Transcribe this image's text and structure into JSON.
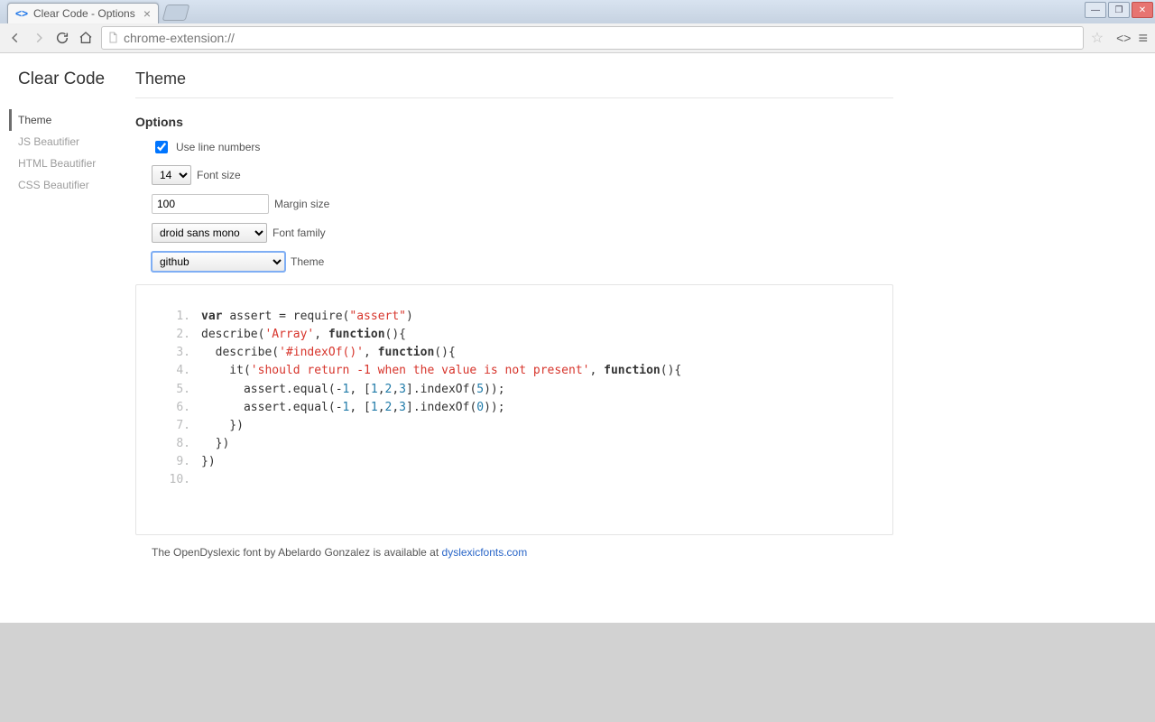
{
  "window": {
    "tab_title": "Clear Code - Options",
    "url": "chrome-extension://"
  },
  "sidebar": {
    "brand": "Clear Code",
    "items": [
      {
        "label": "Theme",
        "active": true
      },
      {
        "label": "JS Beautifier",
        "active": false
      },
      {
        "label": "HTML Beautifier",
        "active": false
      },
      {
        "label": "CSS Beautifier",
        "active": false
      }
    ]
  },
  "main": {
    "heading": "Theme",
    "options_heading": "Options",
    "fields": {
      "use_line_numbers": {
        "label": "Use line numbers",
        "checked": true
      },
      "font_size": {
        "label": "Font size",
        "value": "14"
      },
      "margin_size": {
        "label": "Margin size",
        "value": "100"
      },
      "font_family": {
        "label": "Font family",
        "value": "droid sans mono"
      },
      "theme": {
        "label": "Theme",
        "value": "github"
      }
    },
    "code_lines": [
      {
        "n": "1",
        "tokens": [
          {
            "t": "var ",
            "c": "kw"
          },
          {
            "t": "assert ",
            "c": "fn"
          },
          {
            "t": "= require(",
            "c": "op"
          },
          {
            "t": "\"assert\"",
            "c": "str"
          },
          {
            "t": ")",
            "c": "op"
          }
        ]
      },
      {
        "n": "2",
        "tokens": [
          {
            "t": "describe(",
            "c": "op"
          },
          {
            "t": "'Array'",
            "c": "str"
          },
          {
            "t": ", ",
            "c": "op"
          },
          {
            "t": "function",
            "c": "kw"
          },
          {
            "t": "(){",
            "c": "op"
          }
        ]
      },
      {
        "n": "3",
        "tokens": [
          {
            "t": "  describe(",
            "c": "op"
          },
          {
            "t": "'#indexOf()'",
            "c": "str"
          },
          {
            "t": ", ",
            "c": "op"
          },
          {
            "t": "function",
            "c": "kw"
          },
          {
            "t": "(){",
            "c": "op"
          }
        ]
      },
      {
        "n": "4",
        "tokens": [
          {
            "t": "    it(",
            "c": "op"
          },
          {
            "t": "'should return -1 when the value is not present'",
            "c": "str"
          },
          {
            "t": ", ",
            "c": "op"
          },
          {
            "t": "function",
            "c": "kw"
          },
          {
            "t": "(){",
            "c": "op"
          }
        ]
      },
      {
        "n": "5",
        "tokens": [
          {
            "t": "      assert.equal(-",
            "c": "op"
          },
          {
            "t": "1",
            "c": "num"
          },
          {
            "t": ", [",
            "c": "op"
          },
          {
            "t": "1",
            "c": "num"
          },
          {
            "t": ",",
            "c": "op"
          },
          {
            "t": "2",
            "c": "num"
          },
          {
            "t": ",",
            "c": "op"
          },
          {
            "t": "3",
            "c": "num"
          },
          {
            "t": "].indexOf(",
            "c": "op"
          },
          {
            "t": "5",
            "c": "num"
          },
          {
            "t": "));",
            "c": "op"
          }
        ]
      },
      {
        "n": "6",
        "tokens": [
          {
            "t": "      assert.equal(-",
            "c": "op"
          },
          {
            "t": "1",
            "c": "num"
          },
          {
            "t": ", [",
            "c": "op"
          },
          {
            "t": "1",
            "c": "num"
          },
          {
            "t": ",",
            "c": "op"
          },
          {
            "t": "2",
            "c": "num"
          },
          {
            "t": ",",
            "c": "op"
          },
          {
            "t": "3",
            "c": "num"
          },
          {
            "t": "].indexOf(",
            "c": "op"
          },
          {
            "t": "0",
            "c": "num"
          },
          {
            "t": "));",
            "c": "op"
          }
        ]
      },
      {
        "n": "7",
        "tokens": [
          {
            "t": "    })",
            "c": "op"
          }
        ]
      },
      {
        "n": "8",
        "tokens": [
          {
            "t": "  })",
            "c": "op"
          }
        ]
      },
      {
        "n": "9",
        "tokens": [
          {
            "t": "})",
            "c": "op"
          }
        ]
      },
      {
        "n": "10",
        "tokens": []
      }
    ],
    "footnote": {
      "text": "The OpenDyslexic font by Abelardo Gonzalez is available at ",
      "link_text": "dyslexicfonts.com"
    }
  }
}
